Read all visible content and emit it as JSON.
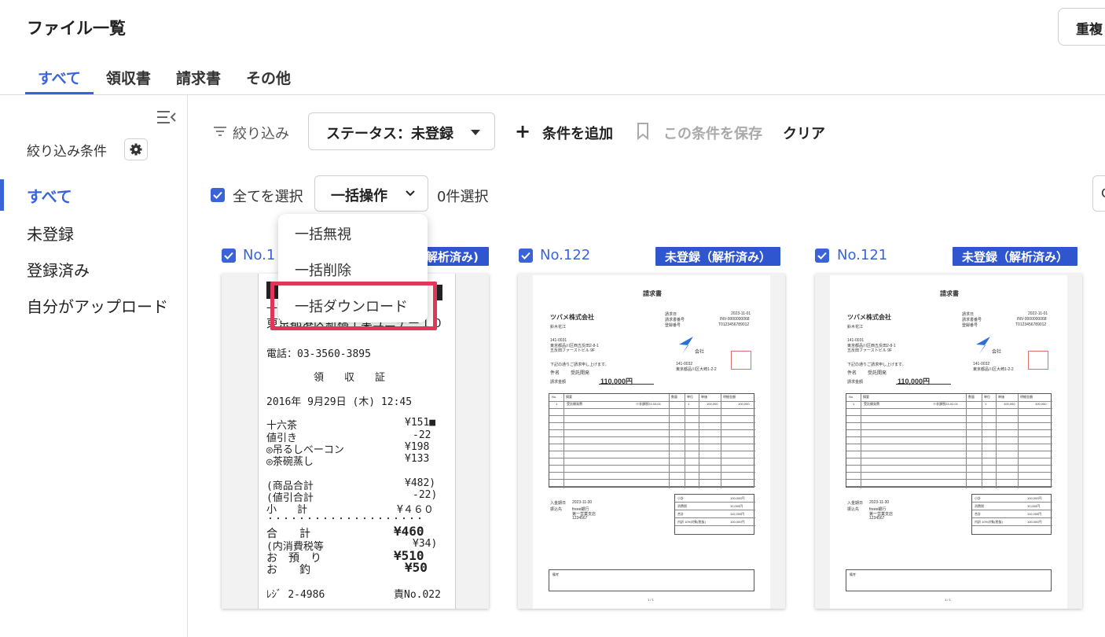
{
  "header": {
    "title": "ファイル一覧",
    "duplicate_button": "重複"
  },
  "tabs": [
    {
      "label": "すべて",
      "active": true
    },
    {
      "label": "領収書",
      "active": false
    },
    {
      "label": "請求書",
      "active": false
    },
    {
      "label": "その他",
      "active": false
    }
  ],
  "sidebar": {
    "filter_conditions_label": "絞り込み条件",
    "items": [
      {
        "label": "すべて",
        "active": true
      },
      {
        "label": "未登録",
        "active": false
      },
      {
        "label": "登録済み",
        "active": false
      },
      {
        "label": "自分がアップロード",
        "active": false
      }
    ]
  },
  "filter_bar": {
    "filter_label": "絞り込み",
    "status_select": "ステータス：未登録",
    "add_condition": "条件を追加",
    "save_condition": "この条件を保存",
    "clear": "クリア"
  },
  "selection_bar": {
    "select_all": "全てを選択",
    "bulk_action": "一括操作",
    "selected_count": "0件選択",
    "right_button": "C"
  },
  "bulk_menu": {
    "items": [
      "一括無視",
      "一括削除",
      "一括ダウンロード"
    ],
    "highlighted_index": 2
  },
  "cards": [
    {
      "number": "No.1",
      "badge": "解析済み)"
    },
    {
      "number": "No.122",
      "badge": "未登録（解析済み）"
    },
    {
      "number": "No.121",
      "badge": "未登録（解析済み）"
    }
  ],
  "receipt": {
    "lines": [
      "一丁",
      "東京都港区新橋工業ユニデー１０",
      "電話：03-3560-3895",
      "領　　収　　証",
      "2016年 9月29日 (木) 12:45",
      "十六茶",
      "値引き",
      "◎吊るしベーコン",
      "◎茶碗蒸し",
      "(商品合計",
      "(値引合計",
      "小　　計",
      "・・・・・・・・・・・・・・・・・・・・",
      "合　　計",
      "(内消費税等",
      "お　預　り",
      "お　　釣",
      "ﾚｼﾞ 2-4986"
    ],
    "amounts": [
      "¥151■",
      "-22",
      "¥198",
      "¥133",
      "¥482)",
      "-22)",
      "¥４６０",
      "¥460",
      "¥34)",
      "¥510",
      "¥50",
      "責No.022"
    ]
  },
  "invoices": [
    {
      "heading": "請求書",
      "company": "ツバメ株式会社",
      "recipient": "鈴木花江",
      "issue_date_label": "請求日",
      "issue_date": "2023-11-01",
      "number_label": "請求書番号",
      "number": "INV-0000000068",
      "reg_label": "登録番号",
      "reg": "T0123456789012",
      "addr1": "141-0031",
      "addr2": "東京都品川区西五反田2-8-1",
      "addr3": "五反田ファーストビル 9F",
      "note": "下記の通りご請求申し上げます。",
      "subject_label": "件名",
      "subject": "受託開発",
      "amount_label": "請求金額",
      "amount": "110,000円",
      "logo_text": "会社",
      "seller_addr1": "141-0032",
      "seller_addr2": "東京都品川区大崎1-2-2",
      "table_headers": [
        "No.",
        "摘要",
        "数量",
        "単位",
        "単価",
        "明細金額"
      ],
      "row": [
        "1",
        "受託開発費",
        "※非課税23-02-01",
        "1",
        "",
        "100,000",
        "100,000"
      ],
      "due_label": "入金期日",
      "due": "2023-11-30",
      "bank_label": "振込先",
      "bank1": "freee銀行",
      "bank2": "第一営業支店",
      "bank3": "1234567",
      "summary": [
        [
          "小計",
          "100,000円"
        ],
        [
          "消費税",
          "10,000円"
        ],
        [
          "合計",
          "110,000円"
        ],
        [
          "内訳 10%対象(税抜)",
          "100,000円"
        ]
      ],
      "remarks_label": "備考",
      "page": "1 / 1"
    },
    {
      "heading": "請求書",
      "company": "ツバメ株式会社",
      "recipient": "鈴木花江",
      "issue_date_label": "請求日",
      "issue_date": "2022-11-01",
      "number_label": "請求書番号",
      "number": "INV-0000000068",
      "reg_label": "登録番号",
      "reg": "T0123456789012",
      "addr1": "141-0031",
      "addr2": "東京都品川区西五反田2-8-1",
      "addr3": "五反田ファーストビル 9F",
      "note": "下記の通りご請求申し上げます。",
      "subject_label": "件名",
      "subject": "受託開発",
      "amount_label": "請求金額",
      "amount": "110,000円",
      "logo_text": "会社",
      "seller_addr1": "141-0032",
      "seller_addr2": "東京都品川区大崎1-2-2",
      "table_headers": [
        "No.",
        "摘要",
        "数量",
        "単位",
        "単価",
        "明細金額"
      ],
      "row": [
        "1",
        "受託開発費",
        "※非課税23-02-01",
        "1",
        "",
        "100,000",
        "100,000"
      ],
      "due_label": "入金期日",
      "due": "2023-11-30",
      "bank_label": "振込先",
      "bank1": "freee銀行",
      "bank2": "第一営業支店",
      "bank3": "1234567",
      "summary": [
        [
          "小計",
          "100,000円"
        ],
        [
          "消費税",
          "10,000円"
        ],
        [
          "合計",
          "110,000円"
        ],
        [
          "内訳 10%対象(税抜)",
          "100,000円"
        ]
      ],
      "remarks_label": "備考",
      "page": "1 / 1"
    }
  ],
  "colors": {
    "accent": "#3b63d9",
    "badge": "#2f55cf",
    "highlight": "#e0365a"
  }
}
